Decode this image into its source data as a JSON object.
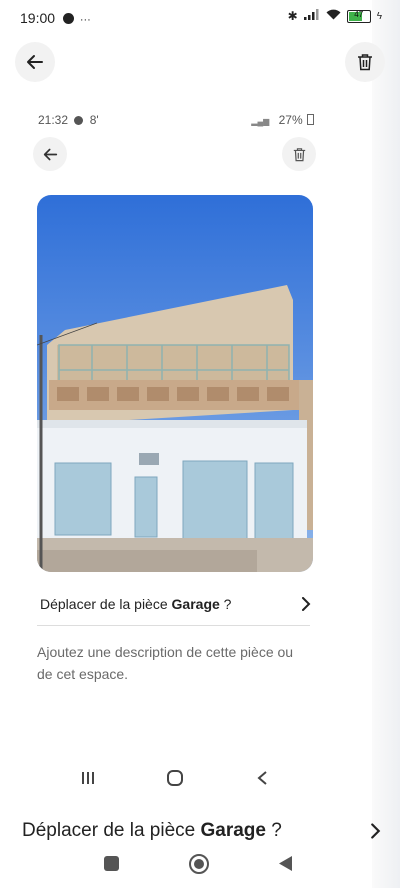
{
  "status_bar": {
    "time": "19:00",
    "battery": "47"
  },
  "inner_status_bar": {
    "time": "21:32",
    "extra": "8'",
    "battery": "27%"
  },
  "move_row": {
    "prefix": "Déplacer de la pièce ",
    "room": "Garage",
    "suffix": " ?"
  },
  "description": {
    "placeholder": "Ajoutez une description de cette pièce ou de cet espace."
  },
  "bottom_row": {
    "prefix": "Déplacer de la pièce ",
    "room": "Garage",
    "suffix": " ?"
  },
  "icons": {
    "back": "arrow-left-icon",
    "delete": "trash-icon",
    "chevron": "chevron-right-icon"
  }
}
